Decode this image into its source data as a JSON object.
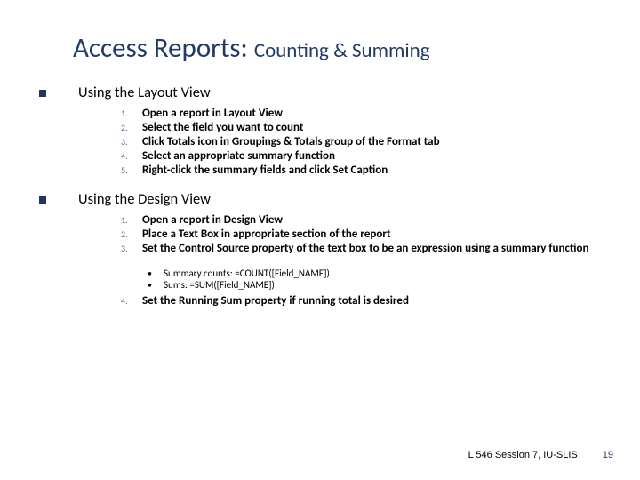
{
  "title": {
    "main": "Access Reports: ",
    "sub": "Counting & Summing"
  },
  "sections": [
    {
      "heading": "Using the Layout View",
      "items": [
        "Open a report in Layout View",
        "Select the field you want to count",
        "Click Totals icon in Groupings & Totals group of the Format tab",
        "Select  an appropriate summary function",
        "Right-click the summary fields and click Set Caption"
      ]
    },
    {
      "heading": "Using the Design View",
      "items": [
        "Open a report in Design View",
        "Place a Text Box in appropriate section of the report",
        {
          "text_pre": "Set the ",
          "bold": "Control Source",
          "text_post": " property of the text box to be an expression using a summary function",
          "sub": [
            "Summary counts: =COUNT([Field_NAME])",
            "Sums: =SUM([Field_NAME])"
          ]
        },
        {
          "text_pre": "Set the ",
          "bold": "Running Sum",
          "text_post": " property if running total is desired"
        }
      ]
    }
  ],
  "footer": {
    "source": "L 546 Session 7, IU-SLIS",
    "page": "19"
  }
}
